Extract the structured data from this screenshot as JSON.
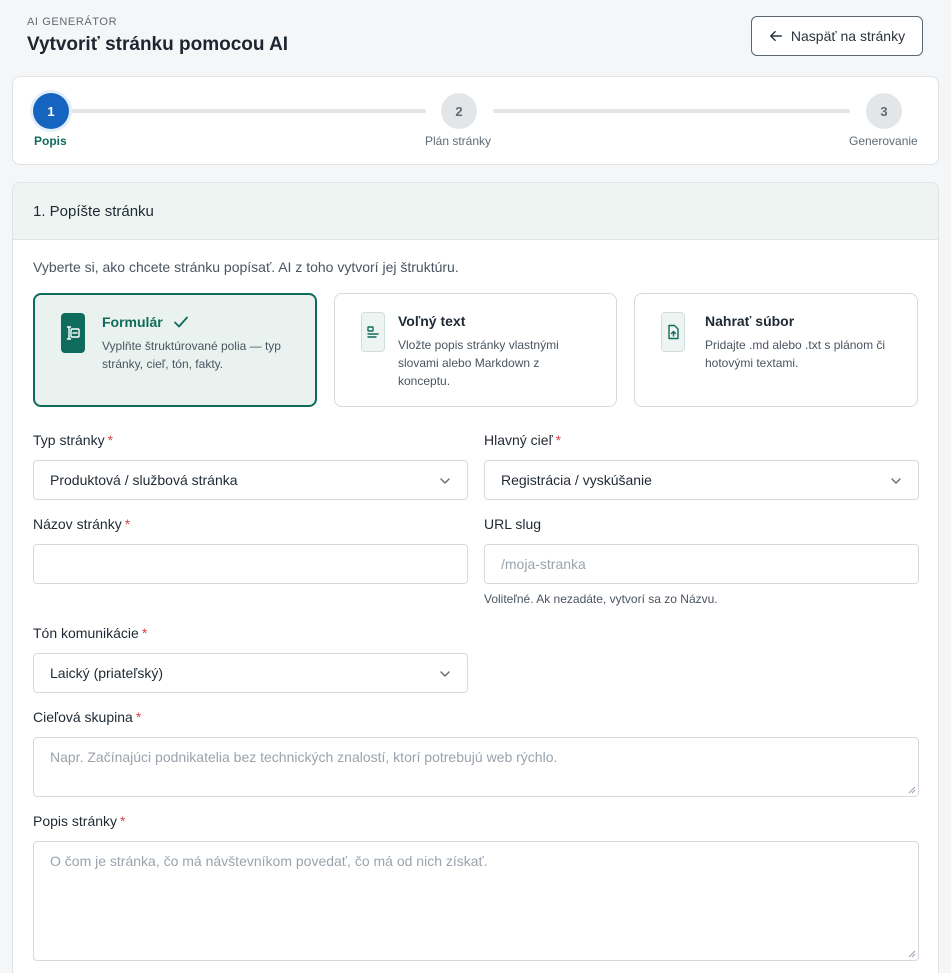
{
  "header": {
    "eyebrow": "AI GENERÁTOR",
    "title": "Vytvoriť stránku pomocou AI",
    "back_label": "Naspäť na stránky"
  },
  "stepper": {
    "steps": [
      {
        "number": "1",
        "label": "Popis",
        "state": "active"
      },
      {
        "number": "2",
        "label": "Plán stránky",
        "state": "inactive"
      },
      {
        "number": "3",
        "label": "Generovanie",
        "state": "inactive"
      }
    ]
  },
  "section": {
    "title": "1. Popíšte stránku",
    "intro": "Vyberte si, ako chcete stránku popísať. AI z toho vytvorí jej štruktúru.",
    "methods": [
      {
        "title": "Formulár",
        "desc_lines": [
          "Vyplňte štruktúrované polia — typ",
          "stránky, cieľ, tón, fakty."
        ],
        "selected": true,
        "icon": "form-icon"
      },
      {
        "title": "Voľný text",
        "desc_lines": [
          "Vložte popis stránky vlastnými",
          "slovami alebo Markdown z",
          "konceptu."
        ],
        "selected": false,
        "icon": "text-icon"
      },
      {
        "title": "Nahrať súbor",
        "desc_lines": [
          "Pridajte .md alebo .txt s plánom či",
          "hotovými textami."
        ],
        "selected": false,
        "icon": "file-upload-icon"
      }
    ]
  },
  "form": {
    "page_type": {
      "label": "Typ stránky",
      "required": "*",
      "value": "Produktová / službová stránka"
    },
    "main_goal": {
      "label": "Hlavný cieľ",
      "required": "*",
      "value": "Registrácia / vyskúšanie"
    },
    "page_name": {
      "label": "Názov stránky",
      "required": "*",
      "value": ""
    },
    "url_slug": {
      "label": "URL slug",
      "placeholder": "/moja-stranka",
      "hint": "Voliteľné. Ak nezadáte, vytvorí sa zo Názvu."
    },
    "tone": {
      "label": "Tón komunikácie",
      "required": "*",
      "value": "Laický (priateľský)"
    },
    "audience": {
      "label": "Cieľová skupina",
      "required": "*",
      "placeholder": "Napr. Začínajúci podnikatelia bez technických znalostí, ktorí potrebujú web rýchlo."
    },
    "description": {
      "label": "Popis stránky",
      "required": "*",
      "placeholder": "O čom je stránka, čo má návštevníkom povedať, čo má od nich získať."
    }
  },
  "colors": {
    "accent": "#0f6b5c",
    "primary": "#1565c0",
    "required": "#d64545"
  }
}
